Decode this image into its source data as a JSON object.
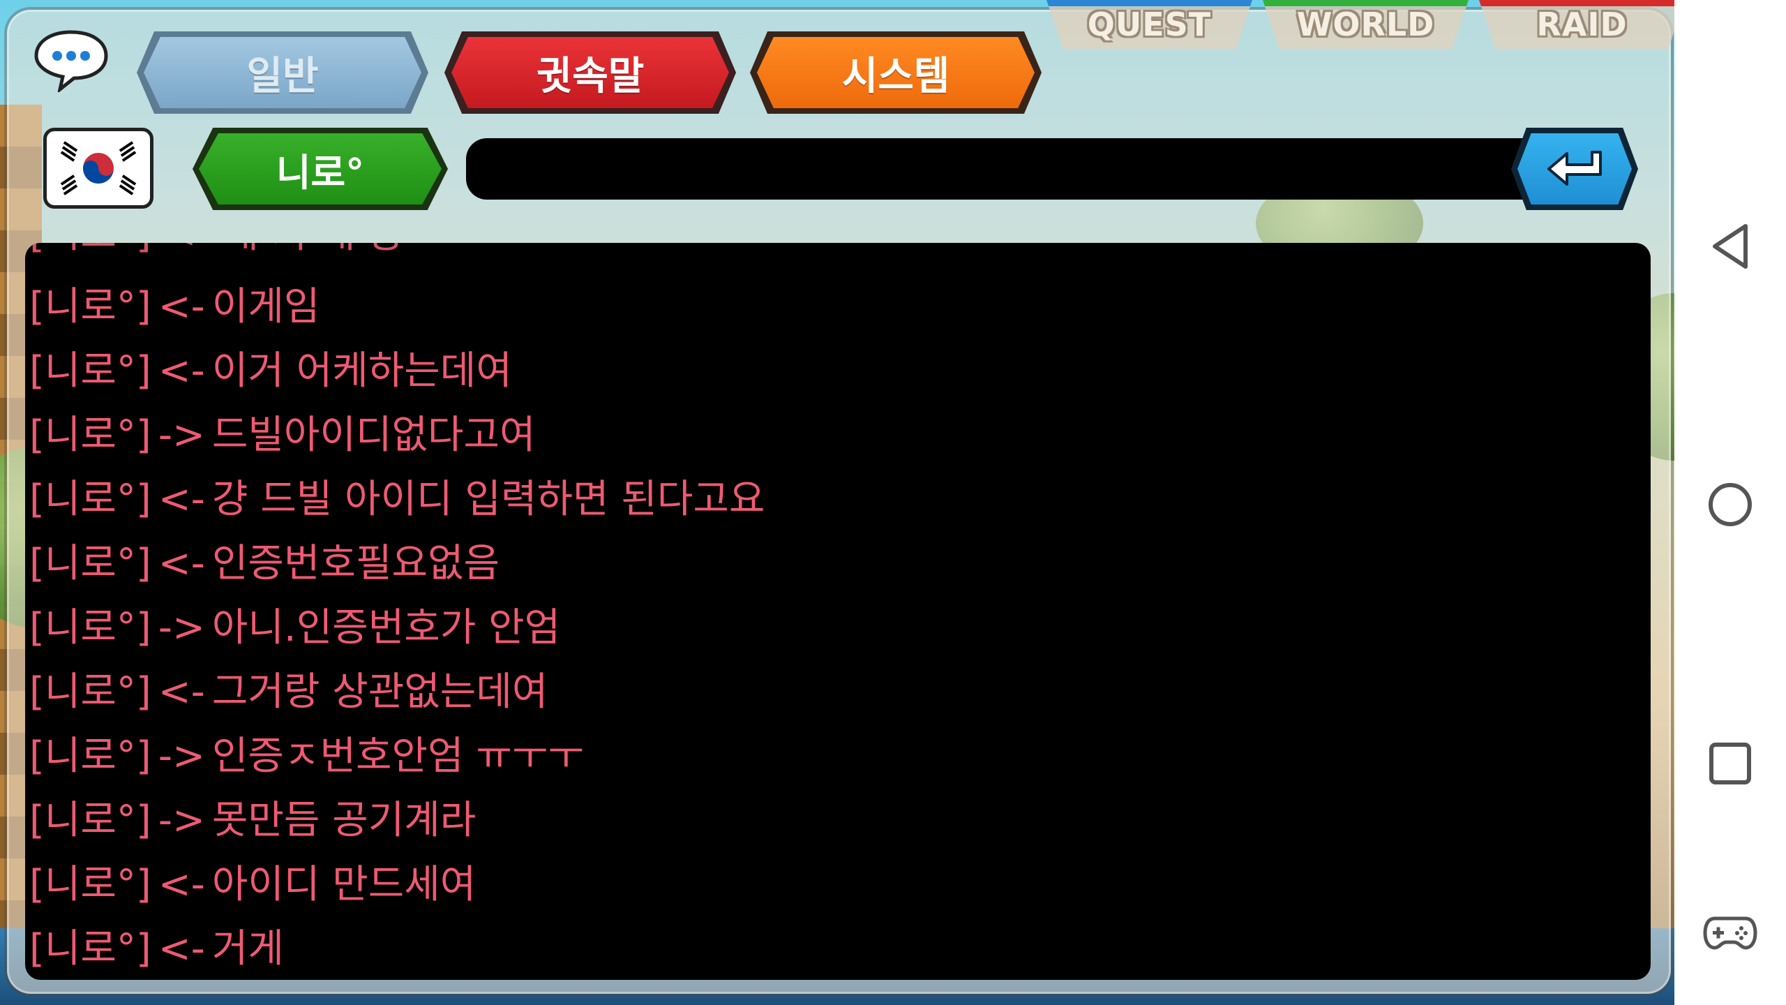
{
  "game_tabs": [
    {
      "label": "QUEST",
      "stripe": "#2c86d6"
    },
    {
      "label": "WORLD",
      "stripe": "#34b03c"
    },
    {
      "label": "RAID",
      "stripe": "#d62b2b"
    }
  ],
  "channel_tabs": {
    "general": "일반",
    "whisper": "귓속말",
    "system": "시스템"
  },
  "target_name": "니로°",
  "input": {
    "value": "",
    "placeholder": ""
  },
  "chat_cut_line": "[니로°] <- 개 기 개 응",
  "chat_lines": [
    {
      "sender": "[니로°]",
      "dir": "<-",
      "text": "이게임"
    },
    {
      "sender": "[니로°]",
      "dir": "<-",
      "text": "이거 어케하는데여"
    },
    {
      "sender": "[니로°]",
      "dir": "->",
      "text": "드빌아이디없다고여"
    },
    {
      "sender": "[니로°]",
      "dir": "<-",
      "text": "걍 드빌 아이디 입력하면 된다고요"
    },
    {
      "sender": "[니로°]",
      "dir": "<-",
      "text": "인증번호필요없음"
    },
    {
      "sender": "[니로°]",
      "dir": "->",
      "text": "아니.인증번호가 안엄"
    },
    {
      "sender": "[니로°]",
      "dir": "<-",
      "text": "그거랑 상관없는데여"
    },
    {
      "sender": "[니로°]",
      "dir": "->",
      "text": "인증ㅈ번호안엄 ㅠㅜㅜ"
    },
    {
      "sender": "[니로°]",
      "dir": "->",
      "text": "못만듬 공기계라"
    },
    {
      "sender": "[니로°]",
      "dir": "<-",
      "text": "아이디 만드세여"
    },
    {
      "sender": "[니로°]",
      "dir": "<-",
      "text": "거게"
    }
  ],
  "colors": {
    "whisper_text": "#ee5a72",
    "tab_general": "#6f9dc4",
    "tab_whisper": "#d0232a",
    "tab_system": "#f57a17",
    "target_green": "#2aa01f",
    "send_blue": "#27a2e0"
  },
  "icons": {
    "chat": "chat-bubble-icon",
    "flag": "korea-flag-icon",
    "send": "enter-arrow-icon",
    "back": "back-triangle-icon",
    "home": "home-circle-icon",
    "recents": "recents-square-icon",
    "gamepad": "gamepad-icon"
  }
}
